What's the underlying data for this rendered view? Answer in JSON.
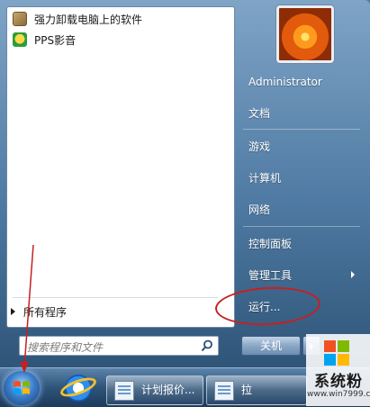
{
  "start_menu": {
    "programs": [
      {
        "label": "强力卸载电脑上的软件",
        "icon": "uninstall-icon"
      },
      {
        "label": "PPS影音",
        "icon": "pps-icon"
      }
    ],
    "all_programs_label": "所有程序",
    "search_placeholder": "搜索程序和文件",
    "right_items": [
      "Administrator",
      "文档",
      "游戏",
      "计算机",
      "网络",
      "控制面板",
      "管理工具",
      "运行..."
    ],
    "shutdown_label": "关机"
  },
  "taskbar": {
    "buttons": [
      {
        "label": "计划报价..."
      },
      {
        "label": "拉"
      }
    ]
  },
  "watermark": {
    "brand": "系统粉",
    "url": "www.win7999.com"
  },
  "colors": {
    "annotation": "#c62020",
    "menu_blue": "#4f7aa3"
  }
}
